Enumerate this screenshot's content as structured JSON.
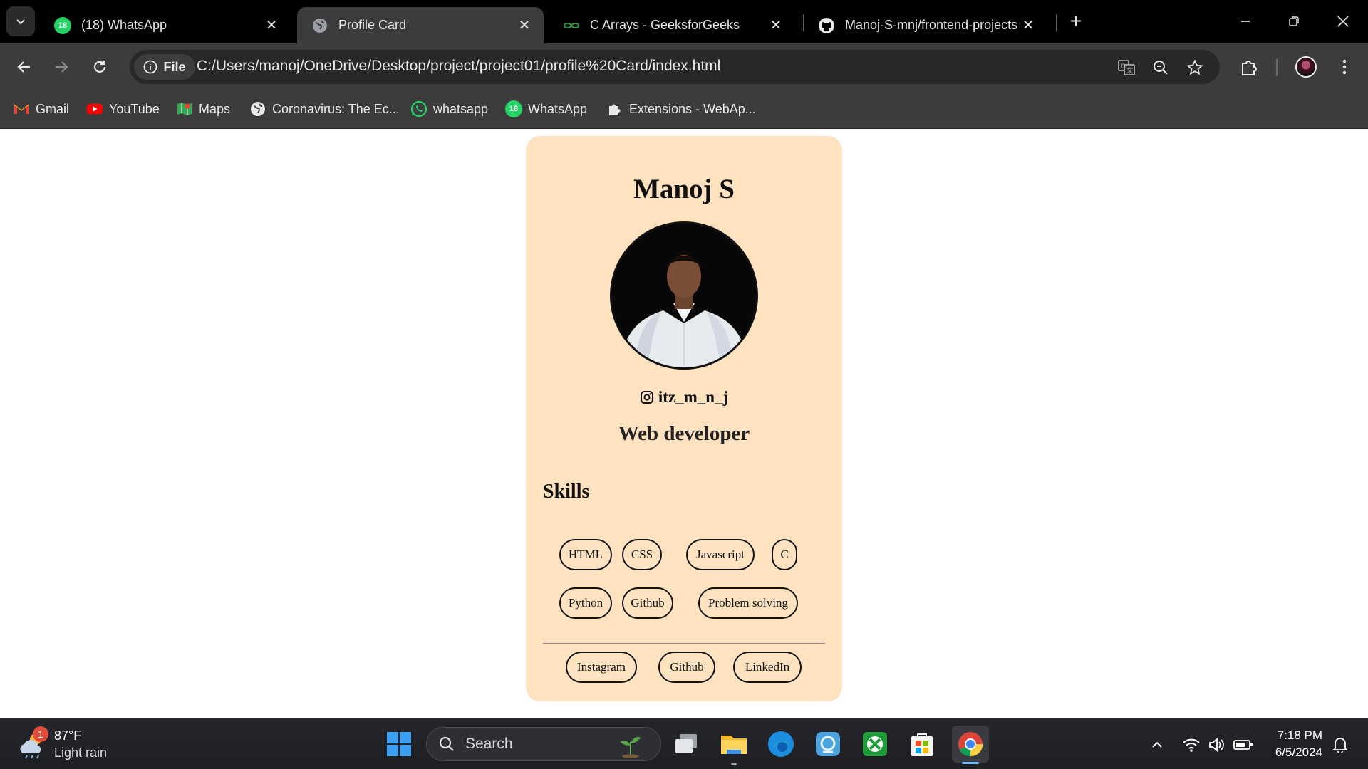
{
  "browser": {
    "tabs": [
      {
        "label": "(18) WhatsApp",
        "badge": "18",
        "active": false
      },
      {
        "label": "Profile Card",
        "active": true
      },
      {
        "label": "C Arrays - GeeksforGeeks",
        "active": false
      },
      {
        "label": "Manoj-S-mnj/frontend-projects",
        "active": false
      }
    ],
    "address": {
      "scheme_chip": "File",
      "url": "C:/Users/manoj/OneDrive/Desktop/project/project01/profile%20Card/index.html"
    },
    "bookmarks": [
      {
        "label": "Gmail",
        "icon": "gmail-icon"
      },
      {
        "label": "YouTube",
        "icon": "youtube-icon"
      },
      {
        "label": "Maps",
        "icon": "maps-icon"
      },
      {
        "label": "Coronavirus: The Ec...",
        "icon": "globe-icon"
      },
      {
        "label": "whatsapp",
        "icon": "whatsapp-icon"
      },
      {
        "label": "WhatsApp",
        "icon": "whatsapp-icon",
        "badge": "18"
      },
      {
        "label": "Extensions - WebAp...",
        "icon": "puzzle-icon"
      }
    ]
  },
  "profile": {
    "name": "Manoj S",
    "handle": "itz_m_n_j",
    "role": "Web developer",
    "skills_title": "Skills",
    "skills": [
      "HTML",
      "CSS",
      "Javascript",
      "C",
      "Python",
      "Github",
      "Problem solving"
    ],
    "links": [
      "Instagram",
      "Github",
      "LinkedIn"
    ],
    "card_color": "#ffe3c0"
  },
  "taskbar": {
    "weather": {
      "temp": "87°F",
      "condition": "Light rain",
      "badge": "1"
    },
    "search_label": "Search",
    "time": "7:18 PM",
    "date": "6/5/2024"
  }
}
